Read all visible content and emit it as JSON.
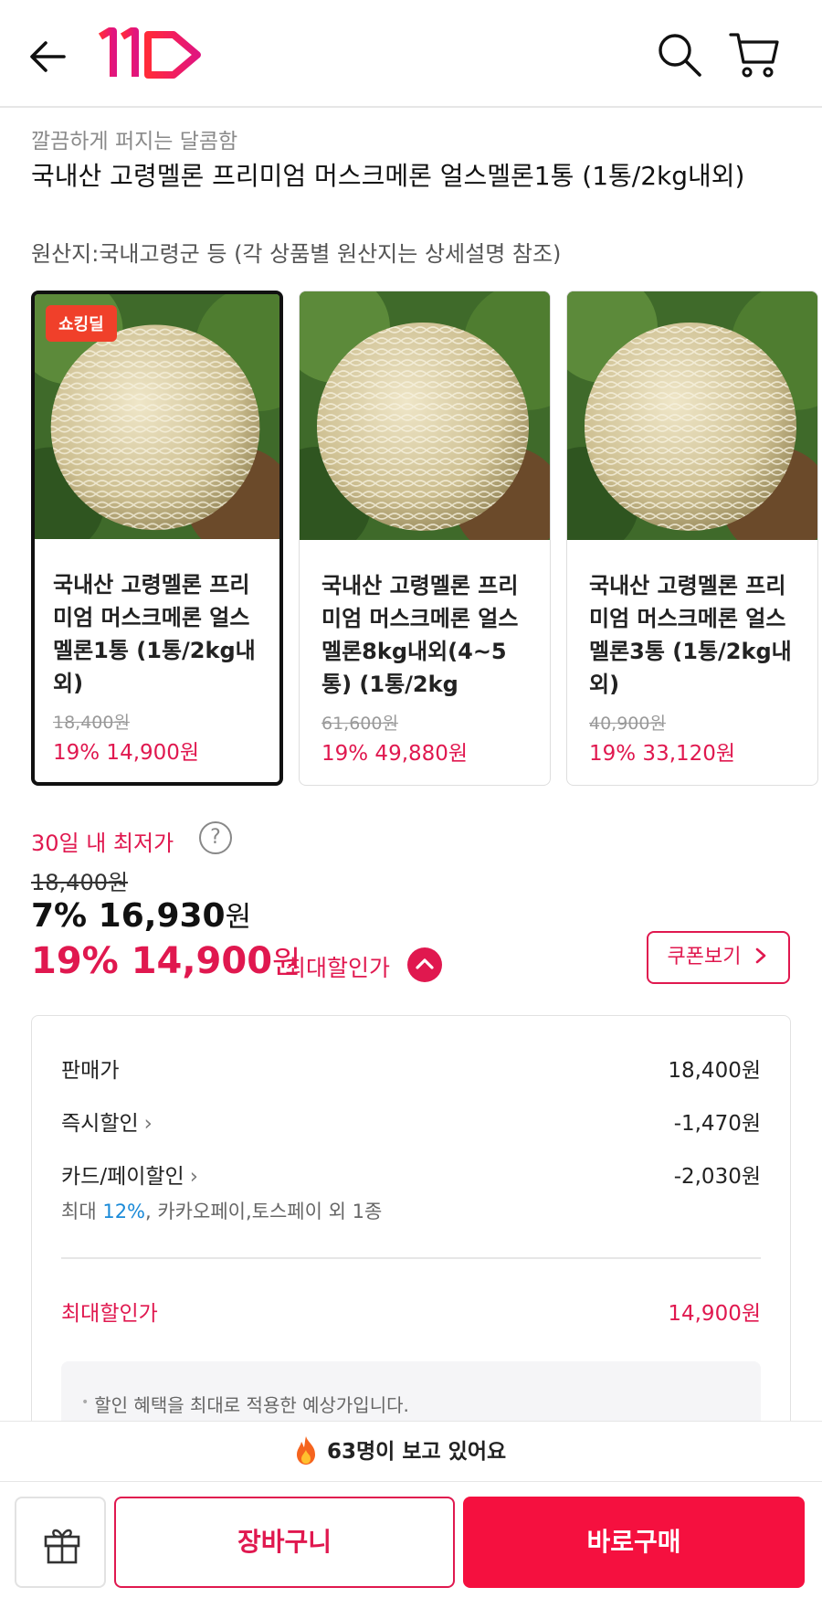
{
  "header": {
    "logo_text": "11st",
    "back_icon": "arrow-left-icon",
    "search_icon": "search-icon",
    "cart_icon": "cart-icon"
  },
  "product": {
    "subtitle": "깔끔하게 퍼지는 달콤함",
    "title": "국내산 고령멜론 프리미엄 머스크메론 얼스멜론1통 (1통/2kg내외)",
    "origin": "원산지:국내고령군 등 (각 상품별 원산지는 상세설명 참조)"
  },
  "options": [
    {
      "badge": "쇼킹딜",
      "name": "국내산 고령멜론 프리미엄 머스크메론 얼스멜론1통 (1통/2kg내외)",
      "original_price": "18,400원",
      "price": "19% 14,900원",
      "selected": true
    },
    {
      "badge": "",
      "name": "국내산 고령멜론 프리미엄 머스크메론 얼스멜론8kg내외(4~5통) (1통/2kg",
      "original_price": "61,600원",
      "price": "19% 49,880원",
      "selected": false
    },
    {
      "badge": "",
      "name": "국내산 고령멜론 프리미엄 머스크메론 얼스멜론3통 (1통/2kg내외)",
      "original_price": "40,900원",
      "price": "19% 33,120원",
      "selected": false
    }
  ],
  "pricing": {
    "lowest_label": "30일 내 최저가",
    "help_symbol": "?",
    "original_price": "18,400원",
    "sale_percent": "7%",
    "sale_amount": "16,930",
    "unit": "원",
    "best_percent": "19%",
    "best_amount": "14,900",
    "best_label": "최대할인가",
    "coupon_button": "쿠폰보기"
  },
  "breakdown": {
    "rows": [
      {
        "label": "판매가",
        "value": "18,400원"
      },
      {
        "label": "즉시할인",
        "value": "-1,470원"
      },
      {
        "label": "카드/페이할인",
        "value": "-2,030원"
      }
    ],
    "card_note_prefix": "최대 ",
    "card_note_highlight": "12%",
    "card_note_suffix": ", 카카오페이,토스페이 외 1종",
    "best_label": "최대할인가",
    "best_value": "14,900원",
    "notice": "할인 혜택을 최대로 적용한 예상가입니다."
  },
  "viewers": {
    "text": "63명이 보고 있어요"
  },
  "bottom_bar": {
    "gift_icon": "gift-icon",
    "cart_button": "장바구니",
    "buy_button": "바로구매"
  },
  "colors": {
    "accent": "#e0184f",
    "buy_button": "#f5103f",
    "badge": "#f0402a",
    "highlight_blue": "#1a8ad8"
  }
}
